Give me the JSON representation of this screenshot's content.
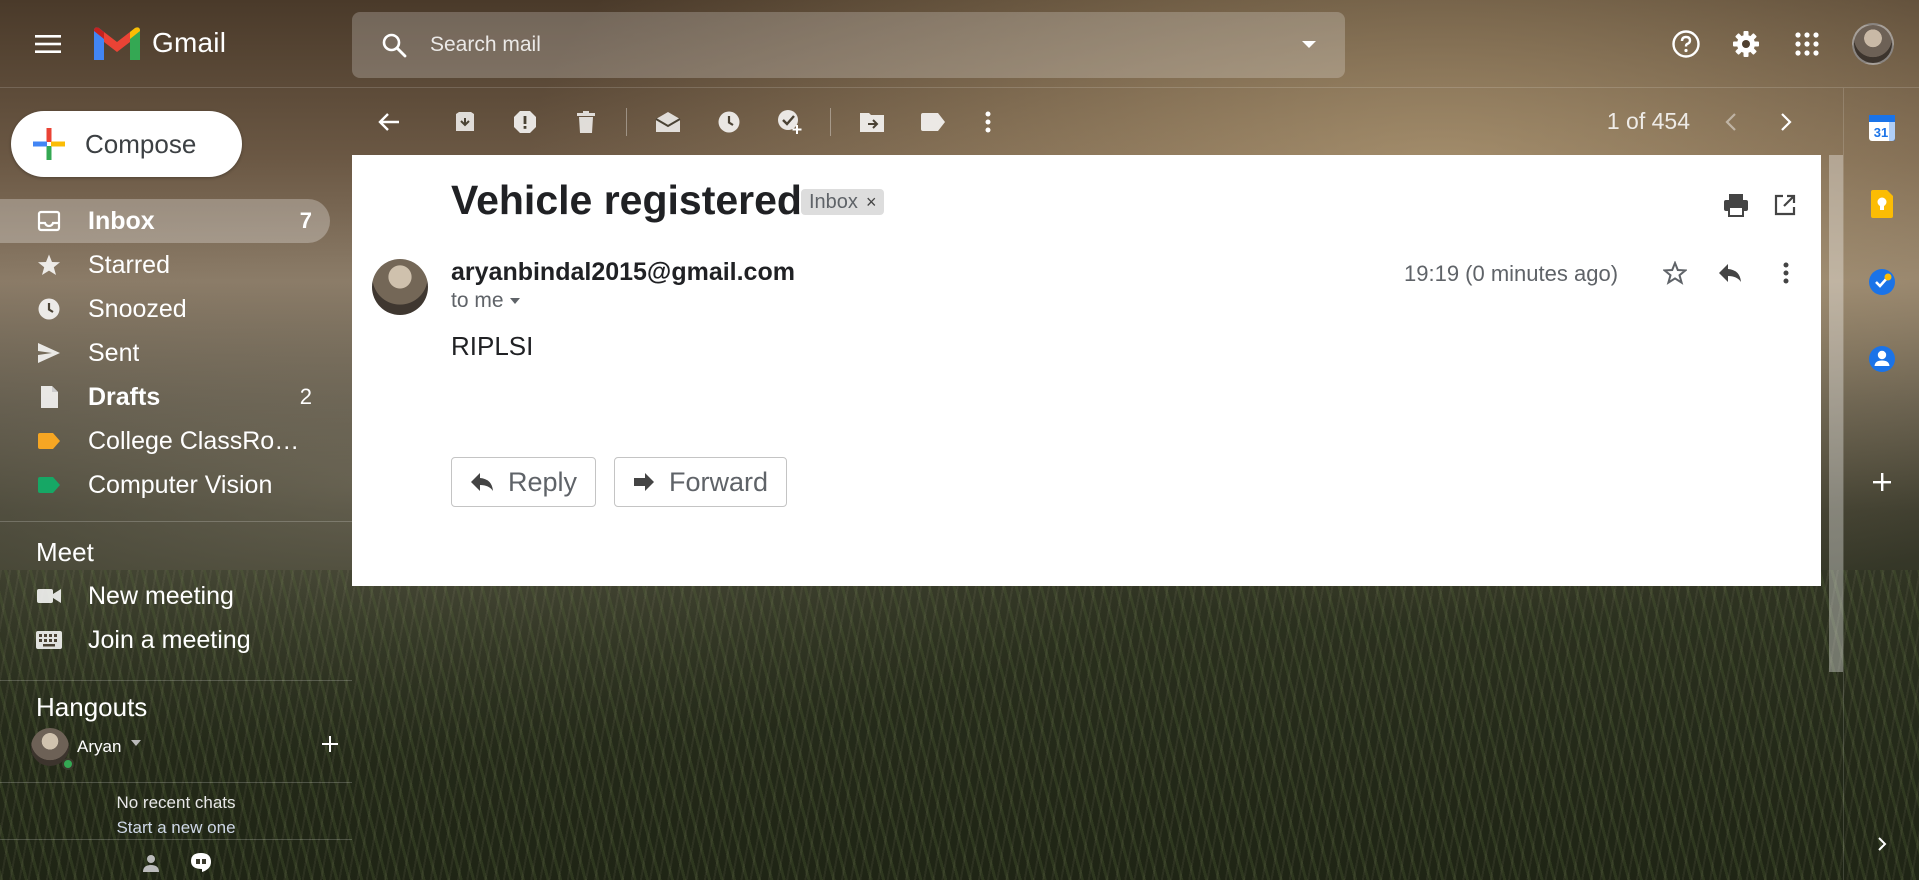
{
  "header": {
    "app_name": "Gmail",
    "search_placeholder": "Search mail"
  },
  "sidebar": {
    "compose_label": "Compose",
    "items": [
      {
        "label": "Inbox",
        "count": "7",
        "icon": "inbox-icon",
        "bold": true,
        "active": true
      },
      {
        "label": "Starred",
        "count": "",
        "icon": "star-icon"
      },
      {
        "label": "Snoozed",
        "count": "",
        "icon": "clock-icon"
      },
      {
        "label": "Sent",
        "count": "",
        "icon": "send-icon"
      },
      {
        "label": "Drafts",
        "count": "2",
        "icon": "draft-icon",
        "bold": true
      },
      {
        "label": "College ClassRo…",
        "count": "",
        "icon": "label-icon",
        "color": "#f6a623"
      },
      {
        "label": "Computer Vision",
        "count": "",
        "icon": "label-icon",
        "color": "#16a765"
      }
    ],
    "meet": {
      "title": "Meet",
      "new_meeting": "New meeting",
      "join_meeting": "Join a meeting"
    },
    "hangouts": {
      "title": "Hangouts",
      "user": "Aryan",
      "no_chats": "No recent chats",
      "start_new": "Start a new one"
    }
  },
  "toolbar": {
    "pager": "1 of 454"
  },
  "email": {
    "subject": "Vehicle registered",
    "label_chip": "Inbox",
    "sender": "aryanbindal2015@gmail.com",
    "recipient": "to me",
    "time": "19:19 (0 minutes ago)",
    "body": "RIPLSI",
    "reply_label": "Reply",
    "forward_label": "Forward"
  },
  "colors": {
    "gmail_red": "#ea4335",
    "calendar_blue": "#1a73e8",
    "keep_yellow": "#fbbc04",
    "label_orange": "#f6a623",
    "label_green": "#16a765"
  }
}
